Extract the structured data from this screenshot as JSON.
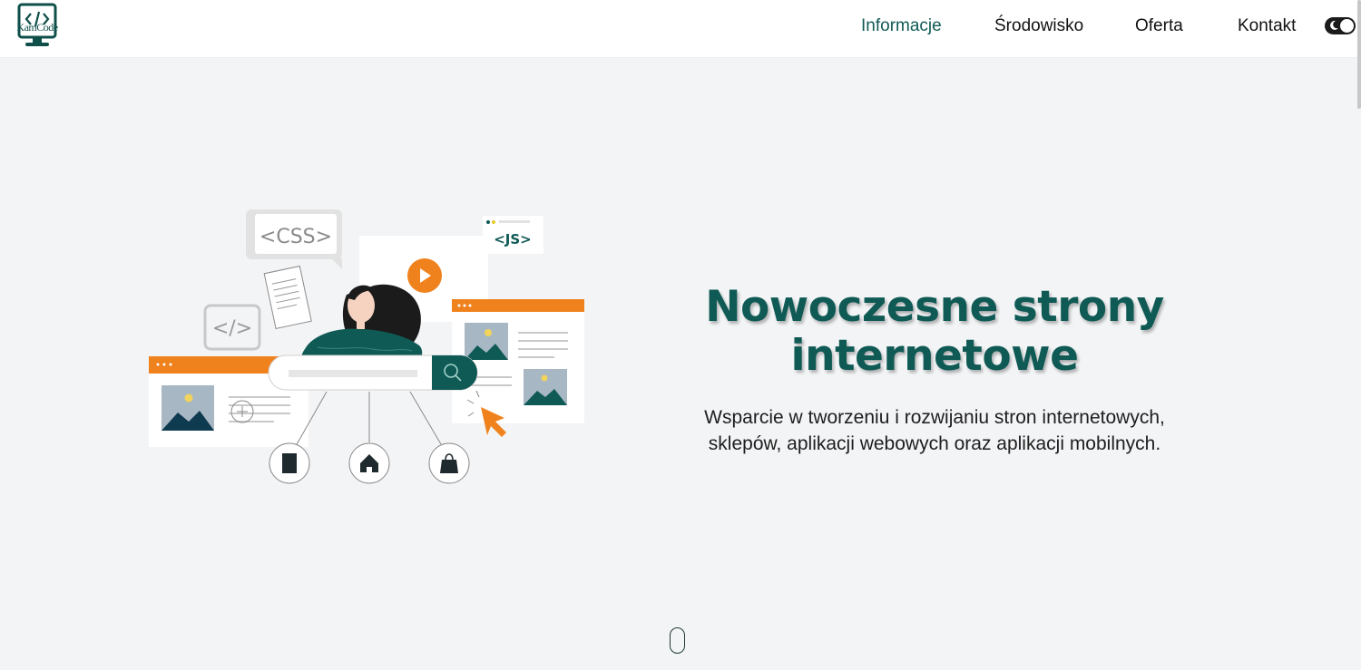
{
  "brand": {
    "logo_text": "KamCode",
    "accent": "#0f5a55",
    "orange": "#f0821e"
  },
  "nav": {
    "items": [
      {
        "label": "Informacje",
        "active": true
      },
      {
        "label": "Środowisko",
        "active": false
      },
      {
        "label": "Oferta",
        "active": false
      },
      {
        "label": "Kontakt",
        "active": false
      }
    ],
    "theme_toggle_icon": "moon-icon"
  },
  "hero": {
    "title_line1": "Nowoczesne strony",
    "title_line2": "internetowe",
    "subtitle_line1": "Wsparcie w tworzeniu i rozwijaniu stron internetowych,",
    "subtitle_line2": "sklepów, aplikacji webowych oraz aplikacji mobilnych.",
    "illustration": {
      "css_label": "<CSS>",
      "js_label": "<JS>",
      "code_label": "</>"
    },
    "scroll_icon": "mouse-scroll-icon"
  }
}
